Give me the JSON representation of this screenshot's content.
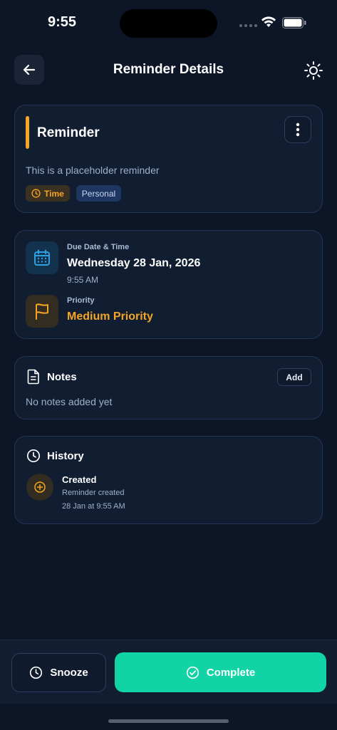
{
  "status_bar": {
    "time": "9:55"
  },
  "header": {
    "title": "Reminder Details",
    "back_icon": "arrow-left-icon",
    "theme_icon": "sun-icon"
  },
  "reminder": {
    "title": "Reminder",
    "description": "This is a placeholder reminder",
    "accent_color": "#f5a524",
    "tags": [
      {
        "label": "Time",
        "icon": "clock-icon"
      },
      {
        "label": "Personal"
      }
    ]
  },
  "due": {
    "label": "Due Date & Time",
    "date": "Wednesday 28 Jan, 2026",
    "time": "9:55 AM"
  },
  "priority": {
    "label": "Priority",
    "value": "Medium Priority",
    "color": "#f5a524"
  },
  "notes": {
    "title": "Notes",
    "add_label": "Add",
    "empty_text": "No notes added yet"
  },
  "history": {
    "title": "History",
    "items": [
      {
        "event": "Created",
        "description": "Reminder created",
        "time": "28 Jan at 9:55 AM"
      }
    ]
  },
  "actions": {
    "snooze_label": "Snooze",
    "complete_label": "Complete",
    "complete_color": "#12d3a5"
  }
}
